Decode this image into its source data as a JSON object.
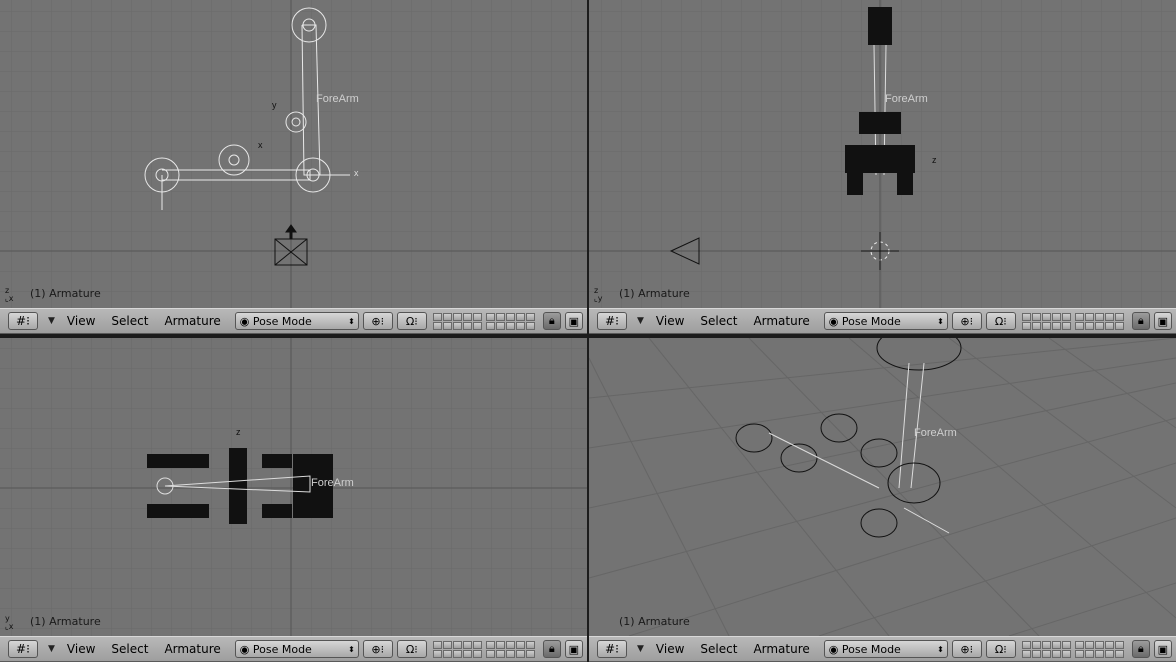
{
  "viewports": [
    {
      "id": "top-left",
      "label": "(1) Armature",
      "axis": "z\nx",
      "bone_label": "ForeArm"
    },
    {
      "id": "top-right",
      "label": "(1) Armature",
      "axis": "z\ny",
      "bone_label": "ForeArm"
    },
    {
      "id": "bottom-left",
      "label": "(1) Armature",
      "axis": "y\nx",
      "bone_label": "ForeArm"
    },
    {
      "id": "bottom-right",
      "label": "(1) Armature",
      "axis": "",
      "bone_label": "ForeArm"
    }
  ],
  "header": {
    "menu_view": "View",
    "menu_select": "Select",
    "menu_armature": "Armature",
    "mode": "Pose Mode",
    "editor_icon": "grid-icon",
    "pivot_icon": "pivot-icon",
    "magnet_icon": "magnet-icon",
    "lock_icon": "lock-icon",
    "render_icon": "image-icon"
  },
  "colors": {
    "viewport_bg": "#737373",
    "grid": "#666666",
    "header": "#acacac"
  }
}
